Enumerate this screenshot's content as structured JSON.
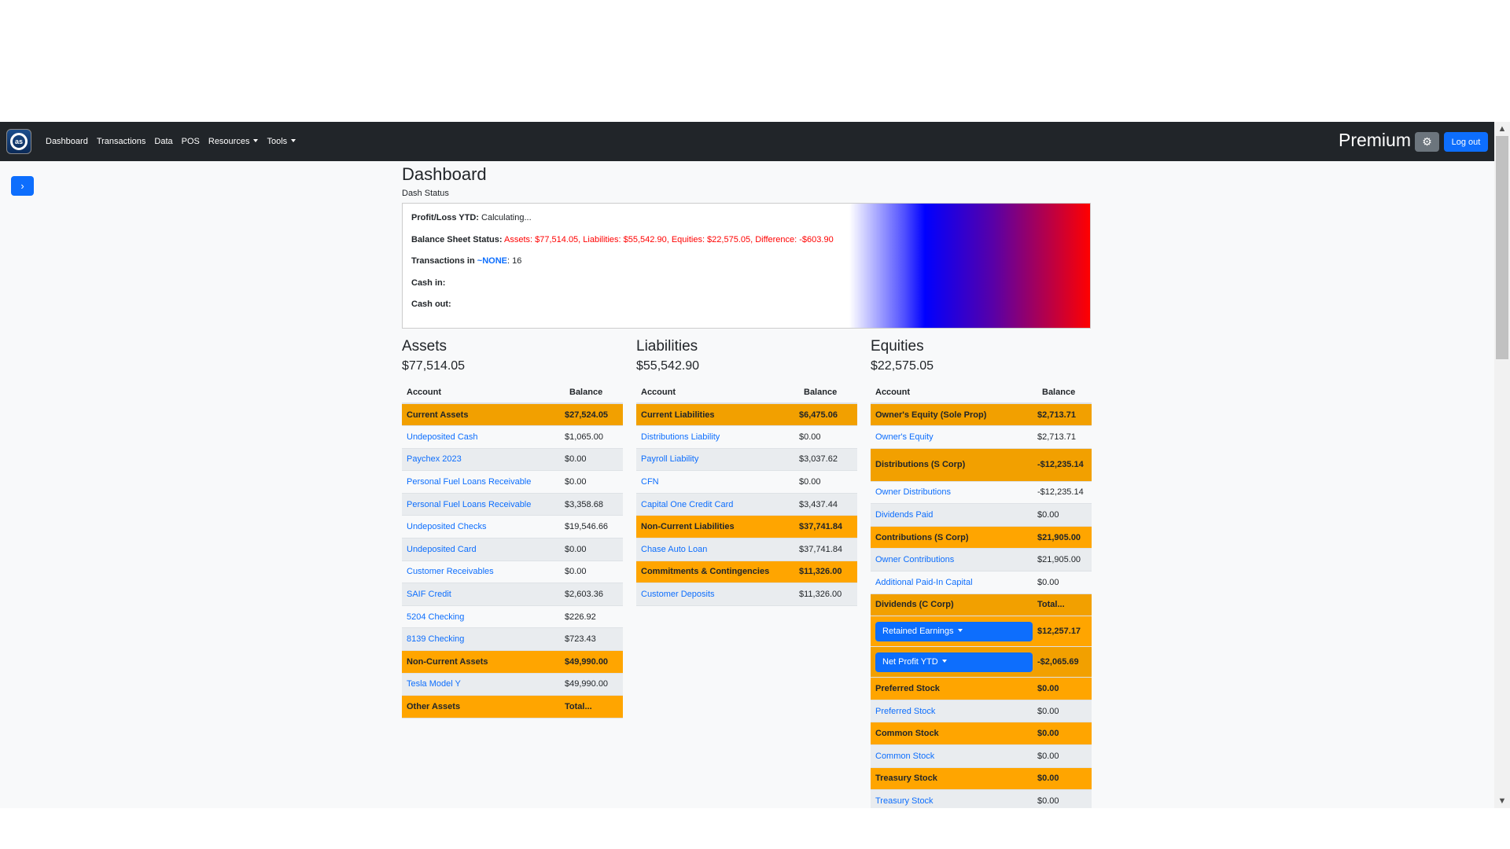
{
  "nav": {
    "logo_text": "as",
    "items": [
      {
        "label": "Dashboard"
      },
      {
        "label": "Transactions"
      },
      {
        "label": "Data"
      },
      {
        "label": "POS"
      },
      {
        "label": "Resources",
        "dropdown": true
      },
      {
        "label": "Tools",
        "dropdown": true
      }
    ],
    "plan": "Premium",
    "settings_icon": "gear-icon",
    "logout": "Log out"
  },
  "sidebar": {
    "toggle_icon": "chevron-right-icon",
    "toggle": "›"
  },
  "page": {
    "title": "Dashboard",
    "subtitle": "Dash Status"
  },
  "status": {
    "pl_label": "Profit/Loss YTD:",
    "pl_value": "Calculating...",
    "bs_label": "Balance Sheet Status:",
    "bs_value": "Assets: $77,514.05, Liabilities: $55,542.90, Equities: $22,575.05, Difference: -$603.90",
    "tx_label": "Transactions in",
    "tx_link": "~NONE",
    "tx_count": ": 16",
    "cash_in": "Cash in:",
    "cash_out": "Cash out:"
  },
  "colors": {
    "group_row": "#ffa500",
    "link": "#0d6efd",
    "navbar": "#212529",
    "error": "#ff0000"
  },
  "columns": {
    "account": "Account",
    "balance": "Balance"
  },
  "sections": [
    {
      "title": "Assets",
      "total": "$77,514.05",
      "rows": [
        {
          "type": "group",
          "name": "Current Assets",
          "balance": "$27,524.05"
        },
        {
          "type": "account",
          "name": "Undeposited Cash",
          "balance": "$1,065.00"
        },
        {
          "type": "account",
          "name": "Paychex 2023",
          "balance": "$0.00"
        },
        {
          "type": "account",
          "name": "Personal Fuel Loans Receivable",
          "balance": "$0.00"
        },
        {
          "type": "account",
          "name": "Personal Fuel Loans Receivable",
          "balance": "$3,358.68"
        },
        {
          "type": "account",
          "name": "Undeposited Checks",
          "balance": "$19,546.66"
        },
        {
          "type": "account",
          "name": "Undeposited Card",
          "balance": "$0.00"
        },
        {
          "type": "account",
          "name": "Customer Receivables",
          "balance": "$0.00"
        },
        {
          "type": "account",
          "name": "SAIF Credit",
          "balance": "$2,603.36"
        },
        {
          "type": "account",
          "name": "5204 Checking",
          "balance": "$226.92"
        },
        {
          "type": "account",
          "name": "8139 Checking",
          "balance": "$723.43"
        },
        {
          "type": "group",
          "name": "Non-Current Assets",
          "balance": "$49,990.00"
        },
        {
          "type": "account",
          "name": "Tesla Model Y",
          "balance": "$49,990.00"
        },
        {
          "type": "group",
          "name": "Other Assets",
          "balance": "Total..."
        }
      ]
    },
    {
      "title": "Liabilities",
      "total": "$55,542.90",
      "rows": [
        {
          "type": "group",
          "name": "Current Liabilities",
          "balance": "$6,475.06"
        },
        {
          "type": "account",
          "name": "Distributions Liability",
          "balance": "$0.00"
        },
        {
          "type": "account",
          "name": "Payroll Liability",
          "balance": "$3,037.62"
        },
        {
          "type": "account",
          "name": "CFN",
          "balance": "$0.00"
        },
        {
          "type": "account",
          "name": "Capital One Credit Card",
          "balance": "$3,437.44"
        },
        {
          "type": "group",
          "name": "Non-Current Liabilities",
          "balance": "$37,741.84"
        },
        {
          "type": "account",
          "name": "Chase Auto Loan",
          "balance": "$37,741.84"
        },
        {
          "type": "group",
          "name": "Commitments & Contingencies",
          "balance": "$11,326.00"
        },
        {
          "type": "account",
          "name": "Customer Deposits",
          "balance": "$11,326.00"
        }
      ]
    },
    {
      "title": "Equities",
      "total": "$22,575.05",
      "rows": [
        {
          "type": "group",
          "name": "Owner's Equity (Sole Prop)",
          "balance": "$2,713.71"
        },
        {
          "type": "account",
          "name": "Owner's Equity",
          "balance": "$2,713.71"
        },
        {
          "type": "group",
          "name": "Distributions (S Corp)",
          "balance": "-$12,235.14",
          "tall": true
        },
        {
          "type": "account",
          "name": "Owner Distributions",
          "balance": "-$12,235.14"
        },
        {
          "type": "account",
          "name": "Dividends Paid",
          "balance": "$0.00"
        },
        {
          "type": "group",
          "name": "Contributions (S Corp)",
          "balance": "$21,905.00"
        },
        {
          "type": "account",
          "name": "Owner Contributions",
          "balance": "$21,905.00"
        },
        {
          "type": "account",
          "name": "Additional Paid-In Capital",
          "balance": "$0.00"
        },
        {
          "type": "group",
          "name": "Dividends (C Corp)",
          "balance": "Total..."
        },
        {
          "type": "dropdown",
          "name": "Retained Earnings",
          "balance": "$12,257.17"
        },
        {
          "type": "dropdown",
          "name": "Net Profit YTD",
          "balance": "-$2,065.69"
        },
        {
          "type": "group",
          "name": "Preferred Stock",
          "balance": "$0.00"
        },
        {
          "type": "account",
          "name": "Preferred Stock",
          "balance": "$0.00"
        },
        {
          "type": "group",
          "name": "Common Stock",
          "balance": "$0.00"
        },
        {
          "type": "account",
          "name": "Common Stock",
          "balance": "$0.00"
        },
        {
          "type": "group",
          "name": "Treasury Stock",
          "balance": "$0.00"
        },
        {
          "type": "account",
          "name": "Treasury Stock",
          "balance": "$0.00"
        }
      ]
    }
  ]
}
